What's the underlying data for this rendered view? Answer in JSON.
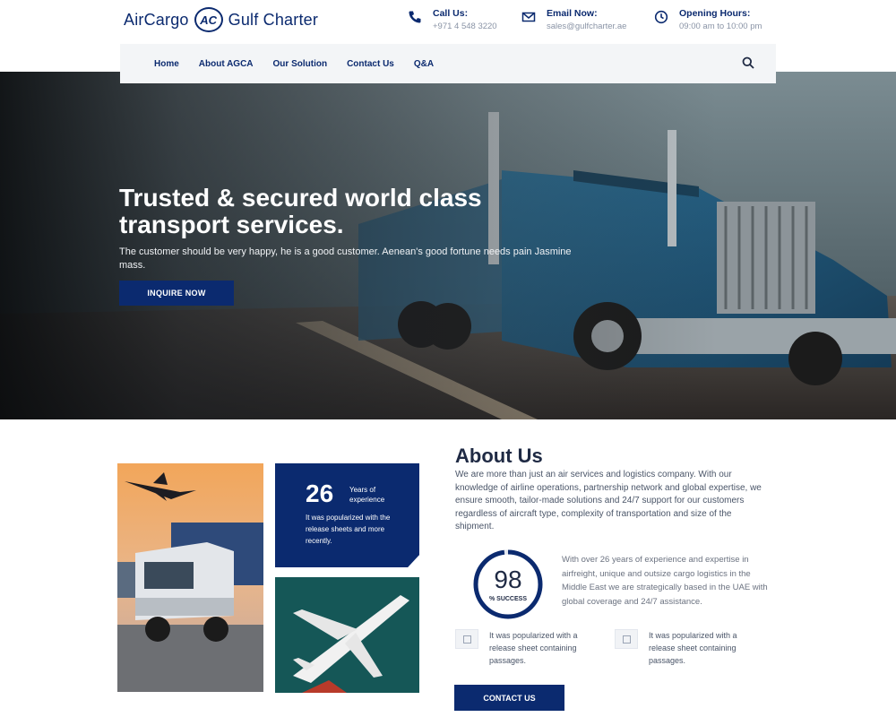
{
  "brand": {
    "name_left": "AirCargo",
    "mark": "AC",
    "name_right": "Gulf Charter"
  },
  "contacts": [
    {
      "icon": "phone-icon",
      "title": "Call Us:",
      "value": "+971 4 548 3220"
    },
    {
      "icon": "email-icon",
      "title": "Email Now:",
      "value": "sales@gulfcharter.ae"
    },
    {
      "icon": "clock-icon",
      "title": "Opening Hours:",
      "value": "09:00 am to 10:00 pm"
    }
  ],
  "nav": {
    "items": [
      "Home",
      "About AGCA",
      "Our Solution",
      "Contact Us",
      "Q&A"
    ],
    "search_icon": "search-icon"
  },
  "hero": {
    "title": "Trusted & secured world class transport services.",
    "subtitle": "The customer should be very happy, he is a good customer. Aenean's good fortune needs pain Jasmine mass.",
    "button": "INQUIRE NOW"
  },
  "experience": {
    "number": "26",
    "label": "Years of experience",
    "text": "It was popularized with the release sheets and more recently."
  },
  "about": {
    "title": "About Us",
    "body": "We are more than just an air services and logistics company. With our knowledge of airline operations, partnership network and global expertise, we ensure smooth, tailor-made solutions and 24/7 support for our customers regardless of aircraft type, complexity of transportation and size of the shipment.",
    "success_value": "98",
    "success_label": "% SUCCESS",
    "body2": "With over 26 years of experience and expertise in airfreight, unique and outsize cargo logistics in the Middle East we are strategically based in the UAE with global coverage and 24/7 assistance.",
    "features": [
      {
        "text": "It was popularized with a release sheet containing passages."
      },
      {
        "text": "It was popularized with a release sheet containing passages."
      }
    ],
    "button": "CONTACT US"
  },
  "colors": {
    "brand": "#0b2a6f",
    "nav_bg": "#f3f5f7",
    "text_muted": "#8a94a6"
  }
}
